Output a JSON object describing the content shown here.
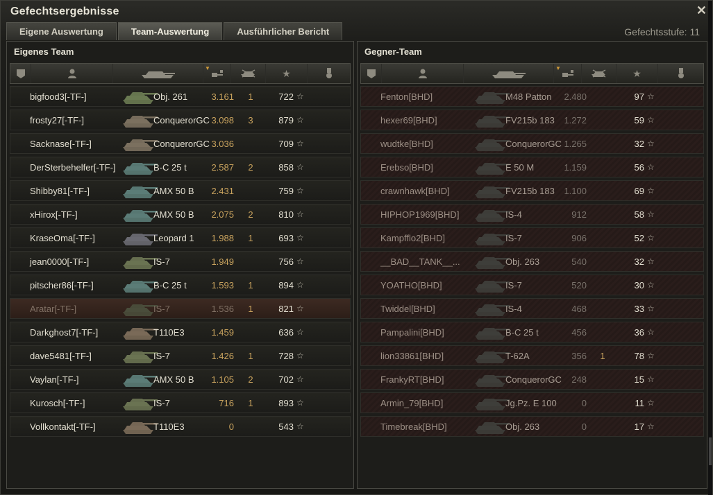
{
  "window": {
    "title": "Gefechtsergebnisse",
    "close_icon": "close-icon"
  },
  "tabs": [
    {
      "label": "Eigene Auswertung"
    },
    {
      "label": "Team-Auswertung"
    },
    {
      "label": "Ausführlicher Bericht"
    }
  ],
  "battle_tier": "Gefechtsstufe: 11",
  "headers": {
    "icons": [
      "rank-icon",
      "player-icon",
      "tank-icon",
      "experience-icon",
      "kills-icon",
      "score-star-icon",
      "medal-icon"
    ]
  },
  "own_team": {
    "title": "Eigenes Team",
    "rows": [
      {
        "name": "bigfood3[-TF-]",
        "tank": "Obj. 261",
        "xp": "3.161",
        "kills": "1",
        "score": "722",
        "dead": false,
        "tank_color": "#6a7a52"
      },
      {
        "name": "frosty27[-TF-]",
        "tank": "ConquerorGC",
        "xp": "3.098",
        "kills": "3",
        "score": "879",
        "dead": false,
        "tank_color": "#7b705f"
      },
      {
        "name": "Sacknase[-TF-]",
        "tank": "ConquerorGC",
        "xp": "3.036",
        "kills": "",
        "score": "709",
        "dead": false,
        "tank_color": "#7b705f"
      },
      {
        "name": "DerSterbehelfer[-TF-]",
        "tank": "B-C 25 t",
        "xp": "2.587",
        "kills": "2",
        "score": "858",
        "dead": false,
        "tank_color": "#5b7c77"
      },
      {
        "name": "Shibby81[-TF-]",
        "tank": "AMX 50 B",
        "xp": "2.431",
        "kills": "",
        "score": "759",
        "dead": false,
        "tank_color": "#5b7c77"
      },
      {
        "name": "xHirox[-TF-]",
        "tank": "AMX 50 B",
        "xp": "2.075",
        "kills": "2",
        "score": "810",
        "dead": false,
        "tank_color": "#5b7c77"
      },
      {
        "name": "KraseOma[-TF-]",
        "tank": "Leopard 1",
        "xp": "1.988",
        "kills": "1",
        "score": "693",
        "dead": false,
        "tank_color": "#6a6a72"
      },
      {
        "name": "jean0000[-TF-]",
        "tank": "IS-7",
        "xp": "1.949",
        "kills": "",
        "score": "756",
        "dead": false,
        "tank_color": "#6a7352"
      },
      {
        "name": "pitscher86[-TF-]",
        "tank": "B-C 25 t",
        "xp": "1.593",
        "kills": "1",
        "score": "894",
        "dead": false,
        "tank_color": "#5b7c77"
      },
      {
        "name": "Aratar[-TF-]",
        "tank": "IS-7",
        "xp": "1.536",
        "kills": "1",
        "score": "821",
        "dead": true,
        "tank_color": "#4a4d3b"
      },
      {
        "name": "Darkghost7[-TF-]",
        "tank": "T110E3",
        "xp": "1.459",
        "kills": "",
        "score": "636",
        "dead": false,
        "tank_color": "#7a6a58"
      },
      {
        "name": "dave5481[-TF-]",
        "tank": "IS-7",
        "xp": "1.426",
        "kills": "1",
        "score": "728",
        "dead": false,
        "tank_color": "#6a7352"
      },
      {
        "name": "Vaylan[-TF-]",
        "tank": "AMX 50 B",
        "xp": "1.105",
        "kills": "2",
        "score": "702",
        "dead": false,
        "tank_color": "#5b7c77"
      },
      {
        "name": "Kurosch[-TF-]",
        "tank": "IS-7",
        "xp": "716",
        "kills": "1",
        "score": "893",
        "dead": false,
        "tank_color": "#6a7352"
      },
      {
        "name": "Vollkontakt[-TF-]",
        "tank": "T110E3",
        "xp": "0",
        "kills": "",
        "score": "543",
        "dead": false,
        "tank_color": "#7a6a58"
      }
    ]
  },
  "enemy_team": {
    "title": "Gegner-Team",
    "rows": [
      {
        "name": "Fenton[BHD]",
        "tank": "M48 Patton",
        "xp": "2.480",
        "kills": "",
        "score": "97",
        "tank_color": "#3e3e3a"
      },
      {
        "name": "hexer69[BHD]",
        "tank": "FV215b 183",
        "xp": "1.272",
        "kills": "",
        "score": "59",
        "tank_color": "#3e3e3a"
      },
      {
        "name": "wudtke[BHD]",
        "tank": "ConquerorGC",
        "xp": "1.265",
        "kills": "",
        "score": "32",
        "tank_color": "#3e3e3a"
      },
      {
        "name": "Erebso[BHD]",
        "tank": "E 50 M",
        "xp": "1.159",
        "kills": "",
        "score": "56",
        "tank_color": "#3e3e3a"
      },
      {
        "name": "crawnhawk[BHD]",
        "tank": "FV215b 183",
        "xp": "1.100",
        "kills": "",
        "score": "69",
        "tank_color": "#3e3e3a"
      },
      {
        "name": "HIPHOP1969[BHD]",
        "tank": "IS-4",
        "xp": "912",
        "kills": "",
        "score": "58",
        "tank_color": "#3e3e3a"
      },
      {
        "name": "Kampfflo2[BHD]",
        "tank": "IS-7",
        "xp": "906",
        "kills": "",
        "score": "52",
        "tank_color": "#3e3e3a"
      },
      {
        "name": "__BAD__TANK__...",
        "tank": "Obj. 263",
        "xp": "540",
        "kills": "",
        "score": "32",
        "tank_color": "#3e3e3a"
      },
      {
        "name": "YOATHO[BHD]",
        "tank": "IS-7",
        "xp": "520",
        "kills": "",
        "score": "30",
        "tank_color": "#3e3e3a"
      },
      {
        "name": "Twiddel[BHD]",
        "tank": "IS-4",
        "xp": "468",
        "kills": "",
        "score": "33",
        "tank_color": "#3e3e3a"
      },
      {
        "name": "Pampalini[BHD]",
        "tank": "B-C 25 t",
        "xp": "456",
        "kills": "",
        "score": "36",
        "tank_color": "#3e3e3a"
      },
      {
        "name": "lion33861[BHD]",
        "tank": "T-62A",
        "xp": "356",
        "kills": "1",
        "score": "78",
        "tank_color": "#3e3e3a"
      },
      {
        "name": "FrankyRT[BHD]",
        "tank": "ConquerorGC",
        "xp": "248",
        "kills": "",
        "score": "15",
        "tank_color": "#3e3e3a"
      },
      {
        "name": "Armin_79[BHD]",
        "tank": "Jg.Pz. E 100",
        "xp": "0",
        "kills": "",
        "score": "11",
        "tank_color": "#3e3e3a"
      },
      {
        "name": "Timebreak[BHD]",
        "tank": "Obj. 263",
        "xp": "0",
        "kills": "",
        "score": "17",
        "tank_color": "#3e3e3a"
      }
    ]
  },
  "colors": {
    "accent": "#c9a35e",
    "dead_row": "#3d2a22",
    "enemy_row": "#2a1d1b"
  }
}
